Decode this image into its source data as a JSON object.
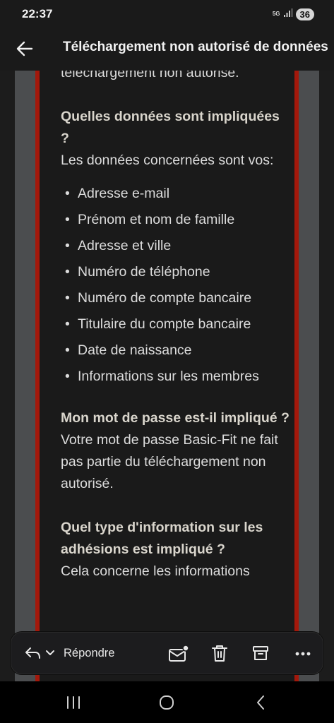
{
  "status": {
    "time": "22:37",
    "network": "5G",
    "battery": "36"
  },
  "header": {
    "title": "Téléchargement non autorisé de données"
  },
  "email": {
    "lead_fragment": "téléchargement non autorisé.",
    "q1_title": "Quelles données sont impliquées ?",
    "q1_text": "Les données concernées sont vos:",
    "data_items": [
      "Adresse e-mail",
      "Prénom et nom de famille",
      "Adresse et ville",
      "Numéro de téléphone",
      "Numéro de compte bancaire",
      "Titulaire du compte bancaire",
      "Date de naissance",
      "Informations sur les membres"
    ],
    "q2_title": "Mon mot de passe est-il impliqué ?",
    "q2_text": "Votre mot de passe Basic-Fit ne fait pas partie du téléchargement non autorisé.",
    "q3_title": "Quel type d'information sur les adhésions est impliqué ?",
    "q3_text": "Cela concerne les informations"
  },
  "toolbar": {
    "reply_label": "Répondre"
  },
  "icons": {
    "back": "arrow-left-icon",
    "reply": "reply-icon",
    "expand": "chevron-down-icon",
    "new_mail": "new-mail-icon",
    "delete": "trash-icon",
    "archive": "archive-icon",
    "more": "more-icon"
  },
  "colors": {
    "accent_red": "#a3180b",
    "side_grey": "#4b4d4f",
    "background": "#1a1a1a"
  }
}
